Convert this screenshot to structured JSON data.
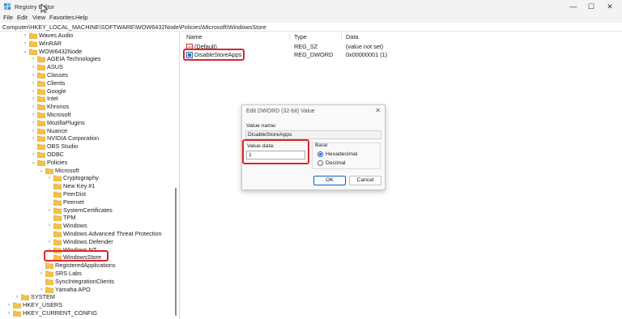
{
  "window": {
    "title": "Registry Editor",
    "minimize": "—",
    "maximize": "☐",
    "close": "✕"
  },
  "menu": [
    "File",
    "Edit",
    "View",
    "Favorites",
    "Help"
  ],
  "address": "Computer\\HKEY_LOCAL_MACHINE\\SOFTWARE\\WOW6432Node\\Policies\\Microsoft\\WindowsStore",
  "tree": [
    {
      "label": "Waves Audio",
      "chev": ">"
    },
    {
      "label": "WinRAR",
      "chev": ">"
    },
    {
      "label": "WOW6432Node",
      "chev": "v"
    },
    {
      "label": "AGEIA Technologies",
      "chev": ">"
    },
    {
      "label": "ASUS",
      "chev": ">"
    },
    {
      "label": "Classes",
      "chev": ">"
    },
    {
      "label": "Clients",
      "chev": ">"
    },
    {
      "label": "Google",
      "chev": ">"
    },
    {
      "label": "Intel",
      "chev": ">"
    },
    {
      "label": "Khronos",
      "chev": ">"
    },
    {
      "label": "Microsoft",
      "chev": ">"
    },
    {
      "label": "MozillaPlugins",
      "chev": ">"
    },
    {
      "label": "Nuance",
      "chev": ">"
    },
    {
      "label": "NVIDIA Corporation",
      "chev": ">"
    },
    {
      "label": "OBS Studio",
      "chev": ""
    },
    {
      "label": "ODBC",
      "chev": ">"
    },
    {
      "label": "Policies",
      "chev": "v"
    },
    {
      "label": "Microsoft",
      "chev": "v"
    },
    {
      "label": "Cryptography",
      "chev": ">"
    },
    {
      "label": "New Key #1",
      "chev": ""
    },
    {
      "label": "PeerDist",
      "chev": ""
    },
    {
      "label": "Peernet",
      "chev": ""
    },
    {
      "label": "SystemCertificates",
      "chev": ">"
    },
    {
      "label": "TPM",
      "chev": ""
    },
    {
      "label": "Windows",
      "chev": ">"
    },
    {
      "label": "Windows Advanced Threat Protection",
      "chev": ""
    },
    {
      "label": "Windows Defender",
      "chev": ">"
    },
    {
      "label": "Windows NT",
      "chev": ">"
    },
    {
      "label": "WindowsStore",
      "chev": ""
    },
    {
      "label": "RegisteredApplications",
      "chev": ""
    },
    {
      "label": "SRS Labs",
      "chev": ">"
    },
    {
      "label": "SyncIntegrationClients",
      "chev": ""
    },
    {
      "label": "Yamaha APO",
      "chev": ">"
    },
    {
      "label": "SYSTEM",
      "chev": ">"
    },
    {
      "label": "HKEY_USERS",
      "chev": ">"
    },
    {
      "label": "HKEY_CURRENT_CONFIG",
      "chev": ">"
    }
  ],
  "list": {
    "headers": {
      "name": "Name",
      "type": "Type",
      "data": "Data"
    },
    "rows": [
      {
        "name": "(Default)",
        "type": "REG_SZ",
        "data": "(value not set)"
      },
      {
        "name": "DisableStoreApps",
        "type": "REG_DWORD",
        "data": "0x00000001 (1)"
      }
    ]
  },
  "dialog": {
    "title": "Edit DWORD (32-bit) Value",
    "close": "✕",
    "value_name_label": "Value name:",
    "value_name": "DisableStoreApps",
    "value_data_label": "Value data:",
    "value_data": "1",
    "base_label": "Base",
    "hex_label": "Hexadecimal",
    "dec_label": "Decimal",
    "ok": "OK",
    "cancel": "Cancel"
  },
  "colors": {
    "highlight": "#e0232b",
    "folder": "#f2c24d",
    "accent": "#0f5fc5"
  }
}
